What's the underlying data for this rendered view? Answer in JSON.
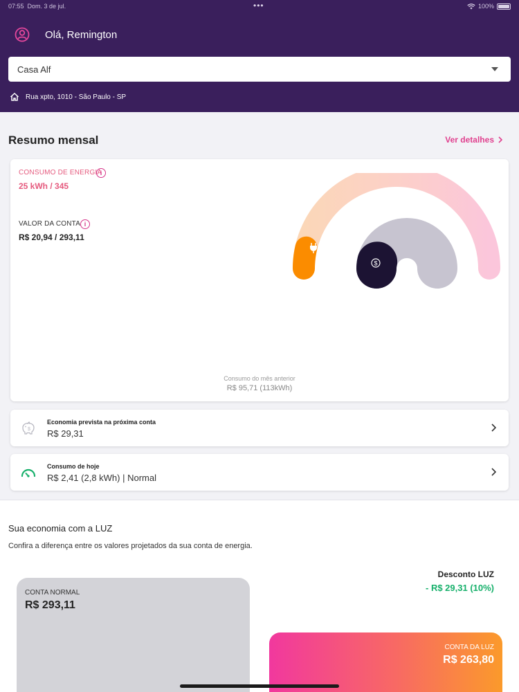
{
  "status_bar": {
    "time": "07:55",
    "date": "Dom. 3 de jul.",
    "battery": "100%"
  },
  "header": {
    "greeting": "Olá, Remington",
    "property_select": {
      "value": "Casa Alf"
    },
    "address": "Rua xpto, 1010 - São Paulo - SP"
  },
  "summary": {
    "title": "Resumo mensal",
    "details_link": "Ver detalhes",
    "energy": {
      "label": "CONSUMO DE ENERGIA",
      "value": "25 kWh / 345",
      "color": "#e55a7e"
    },
    "bill": {
      "label": "VALOR DA CONTA",
      "value": "R$ 20,94 / 293,11",
      "color": "#222222"
    },
    "gauge": {
      "energy_fraction": 0.0725,
      "bill_fraction": 0.0714
    },
    "previous_label": "Consumo do mês anterior",
    "previous_value": "R$ 95,71 (113kWh)"
  },
  "rows": [
    {
      "title": "Economia prevista na próxima conta",
      "value": "R$ 29,31",
      "icon": "piggy-bank-icon"
    },
    {
      "title": "Consumo de hoje",
      "value": "R$ 2,41 (2,8 kWh) | Normal",
      "icon": "speedometer-icon"
    }
  ],
  "economy": {
    "title": "Sua economia com a LUZ",
    "subtitle": "Confira a diferença entre os valores projetados da sua conta de energia.",
    "normal": {
      "label": "CONTA NORMAL",
      "value": "R$ 293,11"
    },
    "discount": {
      "label": "Desconto LUZ",
      "value": "- R$ 29,31 (10%)"
    },
    "luz": {
      "label": "CONTA DA LUZ",
      "value": "R$ 263,80"
    }
  },
  "colors": {
    "header_bg": "#3a1f5c",
    "accent": "#e0408e",
    "success": "#17b06b",
    "orange": "#fb8c00"
  }
}
